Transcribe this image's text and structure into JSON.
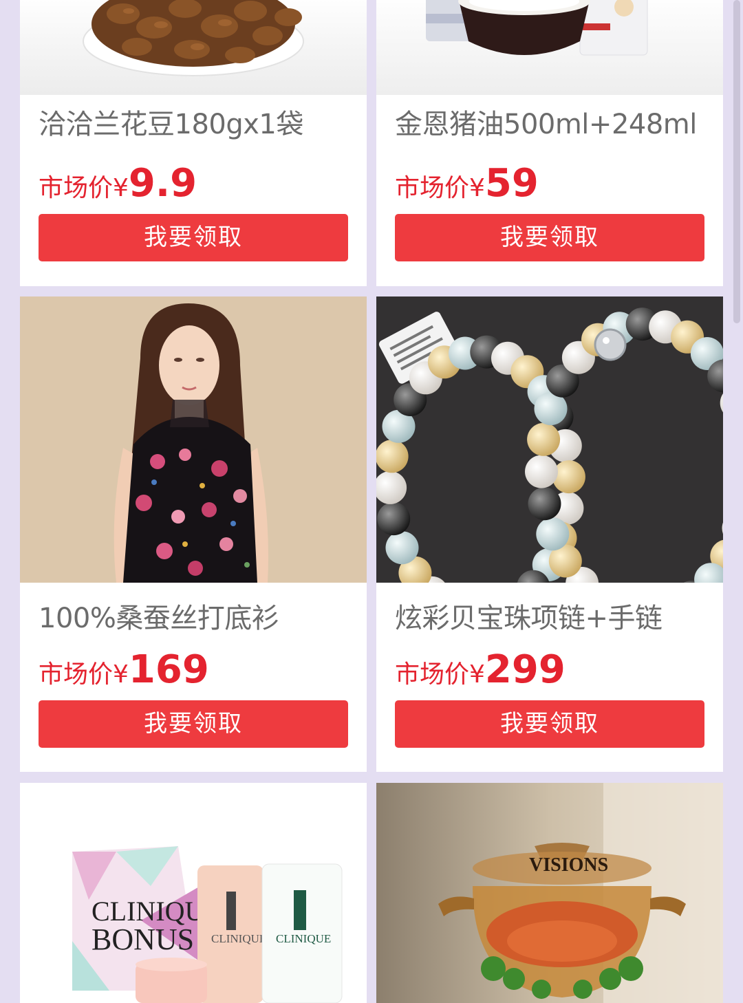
{
  "products": [
    {
      "title": "洽洽兰花豆180gx1袋",
      "price_label": "市场价¥",
      "price": "9.9",
      "button": "我要领取",
      "image_icon": "fava-beans-bowl-image"
    },
    {
      "title": "金恩猪油500ml+248ml",
      "price_label": "市场价¥",
      "price": "59",
      "button": "我要领取",
      "image_icon": "lard-bowl-image"
    },
    {
      "title": "100%桑蚕丝打底衫",
      "price_label": "市场价¥",
      "price": "169",
      "button": "我要领取",
      "image_icon": "floral-silk-top-model-image"
    },
    {
      "title": "炫彩贝宝珠项链+手链",
      "price_label": "市场价¥",
      "price": "299",
      "button": "我要领取",
      "image_icon": "pearl-necklace-bracelet-image"
    },
    {
      "image_icon": "clinique-bonus-set-image",
      "brand_text": [
        "CLINIQUE",
        "BONUS",
        "CLINIQUE",
        "CLINIQUE"
      ]
    },
    {
      "image_icon": "visions-glass-pot-image",
      "brand_text": "VISIONS"
    }
  ],
  "colors": {
    "background": "#e4def2",
    "price_red": "#e4232f",
    "button_red": "#ee3b3f",
    "title_gray": "#6b6b6b"
  }
}
